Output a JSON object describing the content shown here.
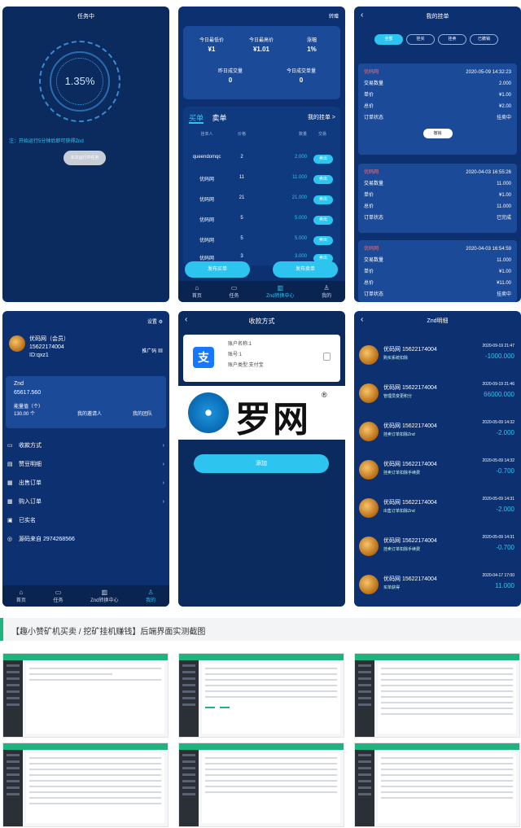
{
  "task": {
    "title": "任务中",
    "percent": "1.35%",
    "notice": "注：开始运行5分钟后即可获得Znd",
    "button": "本次运行中任务"
  },
  "market": {
    "transfer": "转赠",
    "stats": [
      {
        "label": "今日最低价",
        "value": "¥1"
      },
      {
        "label": "今日最高价",
        "value": "¥1.01"
      },
      {
        "label": "涨幅",
        "value": "1%"
      },
      {
        "label": "昨日成交量",
        "value": "0"
      },
      {
        "label": "今日成交单量",
        "value": "0"
      }
    ],
    "tab_buy": "买单",
    "tab_sell": "卖单",
    "my_orders": "我的挂单 >",
    "headers": [
      "挂单人",
      "价格",
      "数量",
      "交易"
    ],
    "rows": [
      {
        "user": "queendomqc",
        "price": "2",
        "qty": "2.000",
        "action": "卖出"
      },
      {
        "user": "优码网",
        "price": "11",
        "qty": "11.000",
        "action": "卖出"
      },
      {
        "user": "优码网",
        "price": "21",
        "qty": "21.000",
        "action": "卖出"
      },
      {
        "user": "优码网",
        "price": "5",
        "qty": "5.000",
        "action": "卖出"
      },
      {
        "user": "优码网",
        "price": "5",
        "qty": "5.000",
        "action": "卖出"
      },
      {
        "user": "优码网",
        "price": "3",
        "qty": "3.000",
        "action": "卖出"
      }
    ],
    "post_buy": "发布买单",
    "post_sell": "发布卖单",
    "tabs": [
      "首页",
      "任务",
      "Znd转换中心",
      "我的"
    ]
  },
  "my_orders": {
    "title": "我的挂单",
    "filters": [
      "全部",
      "挂买",
      "挂卖",
      "已撤销"
    ],
    "cards": [
      {
        "name": "优码网",
        "time": "2020-05-09 14:32:23",
        "qty_label": "交易数量",
        "qty": "2.000",
        "price_label": "单价",
        "price": "¥1.00",
        "total_label": "总价",
        "total": "¥2.00",
        "status_label": "订单状态",
        "status": "挂卖中",
        "cancel": "撤销"
      },
      {
        "name": "优码网",
        "time": "2020-04-03 16:55:26",
        "qty_label": "交易数量",
        "qty": "11.000",
        "price_label": "单价",
        "price": "¥1.00",
        "total_label": "总价",
        "total": "11.000",
        "status_label": "订单状态",
        "status": "已完成"
      },
      {
        "name": "优码网",
        "time": "2020-04-03 16:54:59",
        "qty_label": "交易数量",
        "qty": "11.000",
        "price_label": "单价",
        "price": "¥1.00",
        "total_label": "总价",
        "total": "¥11.00",
        "status_label": "订单状态",
        "status": "挂卖中"
      }
    ]
  },
  "profile": {
    "settings": "设置",
    "name": "优码网（会员）",
    "phone": "15622174004",
    "id": "ID:qxz1",
    "promo": "推广码",
    "coin": "Znd",
    "balance": "65617.560",
    "energy_label": "能量值（个）",
    "energy": "130.00 个",
    "invite": "我的邀请人",
    "team": "我的团队",
    "menu": [
      "收款方式",
      "赞豆明细",
      "出售订单",
      "购入订单",
      "已实名",
      "源码来自 2974268566"
    ],
    "tabs": [
      "首页",
      "任务",
      "Znd转换中心",
      "我的"
    ]
  },
  "payment": {
    "title": "收款方式",
    "account_name": "账户名称:1",
    "account_no": "账号:1",
    "account_type_label": "账户类型:",
    "account_type": "支付宝",
    "logo_text": "罗网",
    "logo_reg": "®",
    "add": "添加"
  },
  "detail": {
    "title": "Znd明细",
    "rows": [
      {
        "name": "优码网 15622174004",
        "desc": "购买系统扣除",
        "time": "2020-09-19 21:47",
        "amt": "-1000.000"
      },
      {
        "name": "优码网 15622174004",
        "desc": "管理员变更积分",
        "time": "2020-09-19 21:46",
        "amt": "66000.000"
      },
      {
        "name": "优码网 15622174004",
        "desc": "挂卖订单扣除Znd",
        "time": "2020-05-09 14:32",
        "amt": "-2.000"
      },
      {
        "name": "优码网 15622174004",
        "desc": "挂卖订单扣除手续费",
        "time": "2020-05-09 14:32",
        "amt": "-0.700"
      },
      {
        "name": "优码网 15622174004",
        "desc": "出售订单扣除Znd",
        "time": "2020-05-09 14:31",
        "amt": "-2.000"
      },
      {
        "name": "优码网 15622174004",
        "desc": "挂卖订单扣除手续费",
        "time": "2020-05-09 14:31",
        "amt": "-0.700"
      },
      {
        "name": "优码网 15622174004",
        "desc": "买单获得",
        "time": "2020-04-17 17:00",
        "amt": "11.000"
      }
    ]
  },
  "caption": "【趣小赞矿机买卖 / 挖矿挂机赚钱】后端界面实测截图"
}
